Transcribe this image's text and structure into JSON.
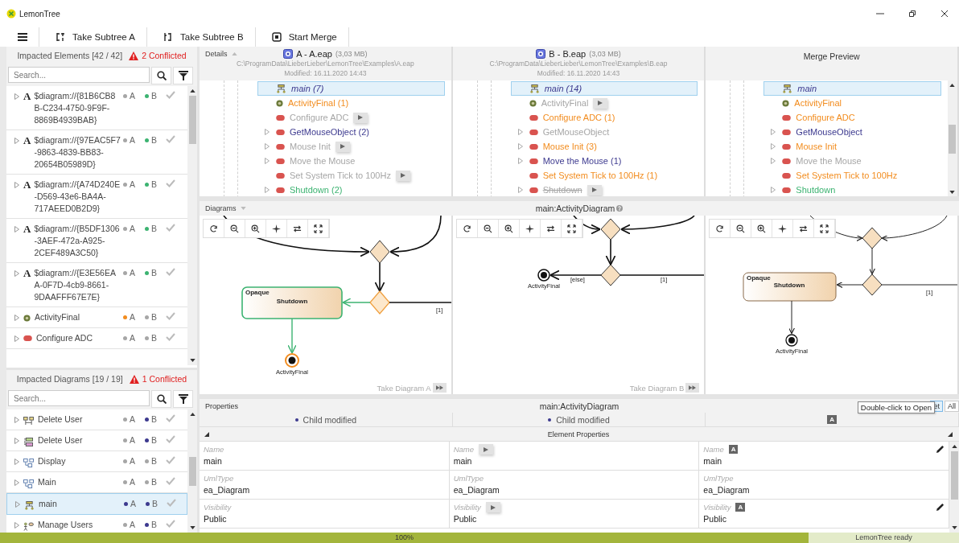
{
  "window": {
    "title": "LemonTree"
  },
  "toolbar": [
    {
      "label": "Take Subtree A",
      "kind": "subtree-a"
    },
    {
      "label": "Take Subtree B",
      "kind": "subtree-b"
    },
    {
      "label": "Start Merge",
      "kind": "merge"
    }
  ],
  "impacted_elements": {
    "title": "Impacted Elements [42 / 42]",
    "conflicts": "2 Conflicted",
    "search_placeholder": "Search...",
    "items": [
      {
        "kind": "glyph",
        "glyph": "A",
        "label": "$diagram://{81B6CB8B-C234-4750-9F9F-8869B4939BAB}",
        "a": {
          "label": "A",
          "color": "#a6a6a6"
        },
        "b": {
          "label": "B",
          "color": "#3cb371"
        },
        "selected": false
      },
      {
        "kind": "glyph",
        "glyph": "A",
        "label": "$diagram://{97EAC5F7-9863-4839-BB83-20654B05989D}",
        "a": {
          "label": "A",
          "color": "#a6a6a6"
        },
        "b": {
          "label": "B",
          "color": "#3cb371"
        },
        "selected": false
      },
      {
        "kind": "glyph",
        "glyph": "A",
        "label": "$diagram://{A74D240E-D569-43e6-BA4A-717AEED0B2D9}",
        "a": {
          "label": "A",
          "color": "#a6a6a6"
        },
        "b": {
          "label": "B",
          "color": "#3cb371"
        },
        "selected": false
      },
      {
        "kind": "glyph",
        "glyph": "A",
        "label": "$diagram://{B5DF1306-3AEF-472a-A925-2CEF489A3C50}",
        "a": {
          "label": "A",
          "color": "#a6a6a6"
        },
        "b": {
          "label": "B",
          "color": "#3cb371"
        },
        "selected": false
      },
      {
        "kind": "glyph",
        "glyph": "A",
        "label": "$diagram://{E3E56EAA-0F7D-4cb9-8661-9DAAFFF67E7E}",
        "a": {
          "label": "A",
          "color": "#a6a6a6"
        },
        "b": {
          "label": "B",
          "color": "#3cb371"
        },
        "selected": false
      },
      {
        "kind": "final",
        "label": "ActivityFinal",
        "a": {
          "label": "A",
          "color": "#f28c1e"
        },
        "b": {
          "label": "B",
          "color": "#a6a6a6"
        },
        "selected": false
      },
      {
        "kind": "action",
        "label": "Configure ADC",
        "a": {
          "label": "A",
          "color": "#a6a6a6"
        },
        "b": {
          "label": "B",
          "color": "#a6a6a6"
        },
        "selected": false
      }
    ]
  },
  "impacted_diagrams": {
    "title": "Impacted Diagrams [19 / 19]",
    "conflicts": "1 Conflicted",
    "search_placeholder": "Search...",
    "items": [
      {
        "kind": "sequence",
        "label": "Delete User",
        "a": {
          "label": "A",
          "color": "#a6a6a6"
        },
        "b": {
          "label": "B",
          "color": "#3d3a8f"
        },
        "selected": false
      },
      {
        "kind": "component",
        "label": "Delete User",
        "a": {
          "label": "A",
          "color": "#a6a6a6"
        },
        "b": {
          "label": "B",
          "color": "#3d3a8f"
        },
        "selected": false
      },
      {
        "kind": "class",
        "label": "Display",
        "a": {
          "label": "A",
          "color": "#a6a6a6"
        },
        "b": {
          "label": "B",
          "color": "#a6a6a6"
        },
        "selected": false
      },
      {
        "kind": "class",
        "label": "Main",
        "a": {
          "label": "A",
          "color": "#a6a6a6"
        },
        "b": {
          "label": "B",
          "color": "#a6a6a6"
        },
        "selected": false
      },
      {
        "kind": "activity",
        "label": "main",
        "a": {
          "label": "A",
          "color": "#3d3a8f"
        },
        "b": {
          "label": "B",
          "color": "#3d3a8f"
        },
        "selected": true
      },
      {
        "kind": "usecase",
        "label": "Manage Users",
        "a": {
          "label": "A",
          "color": "#a6a6a6"
        },
        "b": {
          "label": "B",
          "color": "#3d3a8f"
        },
        "selected": false
      }
    ]
  },
  "details": {
    "title": "Details",
    "columns": [
      {
        "kind": "model",
        "name": "A - A.eap",
        "size": "(3,03 MB)",
        "path": "C:\\ProgramData\\LieberLieber\\LemonTree\\Examples\\A.eap",
        "modified": "Modified: 16.11.2020 14:43",
        "rows": [
          {
            "kind": "diagram",
            "label": "main (7)",
            "color": "#3d3a8f",
            "deleted": false,
            "expandable": false,
            "take": false,
            "selected": true
          },
          {
            "kind": "final",
            "label": "ActivityFinal (1)",
            "color": "#f28c1e",
            "deleted": false,
            "expandable": false,
            "take": false,
            "selected": false
          },
          {
            "kind": "action",
            "label": "Configure ADC",
            "color": "#a6a6a6",
            "deleted": false,
            "expandable": false,
            "take": true,
            "selected": false
          },
          {
            "kind": "action",
            "label": "GetMouseObject (2)",
            "color": "#3d3a8f",
            "deleted": false,
            "expandable": true,
            "take": false,
            "selected": false
          },
          {
            "kind": "action",
            "label": "Mouse Init",
            "color": "#a6a6a6",
            "deleted": false,
            "expandable": true,
            "take": true,
            "selected": false
          },
          {
            "kind": "action",
            "label": "Move the Mouse",
            "color": "#a6a6a6",
            "deleted": false,
            "expandable": true,
            "take": false,
            "selected": false
          },
          {
            "kind": "action",
            "label": "Set System Tick to 100Hz",
            "color": "#a6a6a6",
            "deleted": false,
            "expandable": false,
            "take": true,
            "selected": false
          },
          {
            "kind": "action",
            "label": "Shutdown (2)",
            "color": "#3cb371",
            "deleted": false,
            "expandable": true,
            "take": false,
            "selected": false
          }
        ]
      },
      {
        "kind": "model",
        "name": "B - B.eap",
        "size": "(3,03 MB)",
        "path": "C:\\ProgramData\\LieberLieber\\LemonTree\\Examples\\B.eap",
        "modified": "Modified: 16.11.2020 14:43",
        "rows": [
          {
            "kind": "diagram",
            "label": "main (14)",
            "color": "#3d3a8f",
            "deleted": false,
            "expandable": false,
            "take": false,
            "selected": true
          },
          {
            "kind": "final",
            "label": "ActivityFinal",
            "color": "#a6a6a6",
            "deleted": false,
            "expandable": false,
            "take": true,
            "selected": false
          },
          {
            "kind": "action",
            "label": "Configure ADC (1)",
            "color": "#f28c1e",
            "deleted": false,
            "expandable": false,
            "take": false,
            "selected": false
          },
          {
            "kind": "action",
            "label": "GetMouseObject",
            "color": "#a6a6a6",
            "deleted": false,
            "expandable": true,
            "take": false,
            "selected": false
          },
          {
            "kind": "action",
            "label": "Mouse Init (3)",
            "color": "#f28c1e",
            "deleted": false,
            "expandable": true,
            "take": false,
            "selected": false
          },
          {
            "kind": "action",
            "label": "Move the Mouse (1)",
            "color": "#3d3a8f",
            "deleted": false,
            "expandable": true,
            "take": false,
            "selected": false
          },
          {
            "kind": "action",
            "label": "Set System Tick to 100Hz (1)",
            "color": "#f28c1e",
            "deleted": false,
            "expandable": false,
            "take": false,
            "selected": false
          },
          {
            "kind": "action",
            "label": "Shutdown",
            "color": "#a6a6a6",
            "deleted": true,
            "expandable": true,
            "take": true,
            "selected": false
          }
        ]
      },
      {
        "kind": "preview",
        "name": "Merge Preview",
        "rows": [
          {
            "kind": "diagram",
            "label": "main",
            "color": "#3d3a8f",
            "deleted": false,
            "expandable": false,
            "take": false,
            "selected": true
          },
          {
            "kind": "final",
            "label": "ActivityFinal",
            "color": "#f28c1e",
            "deleted": false,
            "expandable": false,
            "take": false,
            "selected": false
          },
          {
            "kind": "action",
            "label": "Configure ADC",
            "color": "#f28c1e",
            "deleted": false,
            "expandable": false,
            "take": false,
            "selected": false
          },
          {
            "kind": "action",
            "label": "GetMouseObject",
            "color": "#3d3a8f",
            "deleted": false,
            "expandable": true,
            "take": false,
            "selected": false
          },
          {
            "kind": "action",
            "label": "Mouse Init",
            "color": "#f28c1e",
            "deleted": false,
            "expandable": true,
            "take": false,
            "selected": false
          },
          {
            "kind": "action",
            "label": "Move the Mouse",
            "color": "#a6a6a6",
            "deleted": false,
            "expandable": true,
            "take": false,
            "selected": false
          },
          {
            "kind": "action",
            "label": "Set System Tick to 100Hz",
            "color": "#f28c1e",
            "deleted": false,
            "expandable": false,
            "take": false,
            "selected": false
          },
          {
            "kind": "action",
            "label": "Shutdown",
            "color": "#3cb371",
            "deleted": false,
            "expandable": true,
            "take": false,
            "selected": false
          }
        ]
      }
    ]
  },
  "diagrams": {
    "title": "Diagrams",
    "subject": "main:ActivityDiagram",
    "panes": [
      {
        "kind": "a",
        "stereotype": "Opaque",
        "action": "Shutdown",
        "final": "ActivityFinal",
        "guards": [
          "[1]"
        ],
        "take_label": "Take Diagram A"
      },
      {
        "kind": "b",
        "final": "ActivityFinal",
        "guards": [
          "[else]",
          "[1]"
        ],
        "take_label": "Take Diagram B"
      },
      {
        "kind": "merge",
        "stereotype": "Opaque",
        "action": "Shutdown",
        "final": "ActivityFinal",
        "guards": [
          "[1]"
        ]
      }
    ]
  },
  "properties": {
    "title": "Properties",
    "subject": "main:ActivityDiagram",
    "view_buttons": [
      {
        "label": "et",
        "selected": true
      },
      {
        "label": "All",
        "selected": false
      }
    ],
    "tooltip": "Double-click to Open",
    "summary": [
      {
        "kind": "dot",
        "text": "Child modified",
        "color": "#3d3a8f"
      },
      {
        "kind": "dot",
        "text": "Child modified",
        "color": "#3d3a8f"
      },
      {
        "kind": "badge",
        "text": "A"
      }
    ],
    "section": "Element Properties",
    "rows": [
      [
        {
          "label": "Name",
          "value": "main"
        },
        {
          "label": "Name",
          "value": "main",
          "take": true
        },
        {
          "label": "Name",
          "value": "main",
          "badge": "A",
          "editable": true
        }
      ],
      [
        {
          "label": "UmlType",
          "value": "ea_Diagram"
        },
        {
          "label": "UmlType",
          "value": "ea_Diagram"
        },
        {
          "label": "UmlType",
          "value": "ea_Diagram"
        }
      ],
      [
        {
          "label": "Visibility",
          "value": "Public"
        },
        {
          "label": "Visibility",
          "value": "Public",
          "take": true
        },
        {
          "label": "Visibility",
          "value": "Public",
          "badge": "A",
          "editable": true
        }
      ]
    ]
  },
  "status_bar": {
    "level": 1,
    "progress": "100%",
    "message": "LemonTree ready"
  }
}
